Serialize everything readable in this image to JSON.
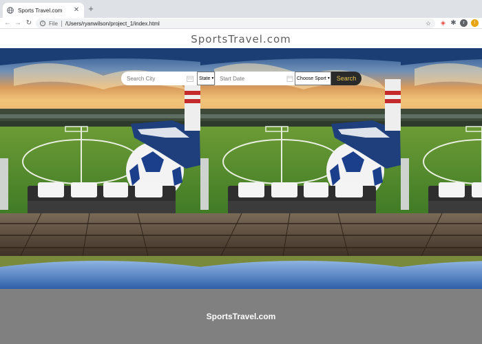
{
  "browser": {
    "tab_title": "Sports Travel.com",
    "new_tab_icon": "plus-icon",
    "url_scheme": "File",
    "url": "/Users/ryanwilson/project_1/index.html",
    "profile_initial": "r"
  },
  "header": {
    "logo": "SportsTravel.com"
  },
  "search": {
    "city_placeholder": "Search City",
    "state_label": "State",
    "date_placeholder": "Start Date",
    "sport_label": "Choose Sport",
    "button_label": "Search"
  },
  "footer": {
    "text": "SportsTravel.com"
  },
  "colors": {
    "footer_bg": "#808080",
    "search_button_bg": "#2a2a2a",
    "search_button_text": "#f0c850"
  }
}
